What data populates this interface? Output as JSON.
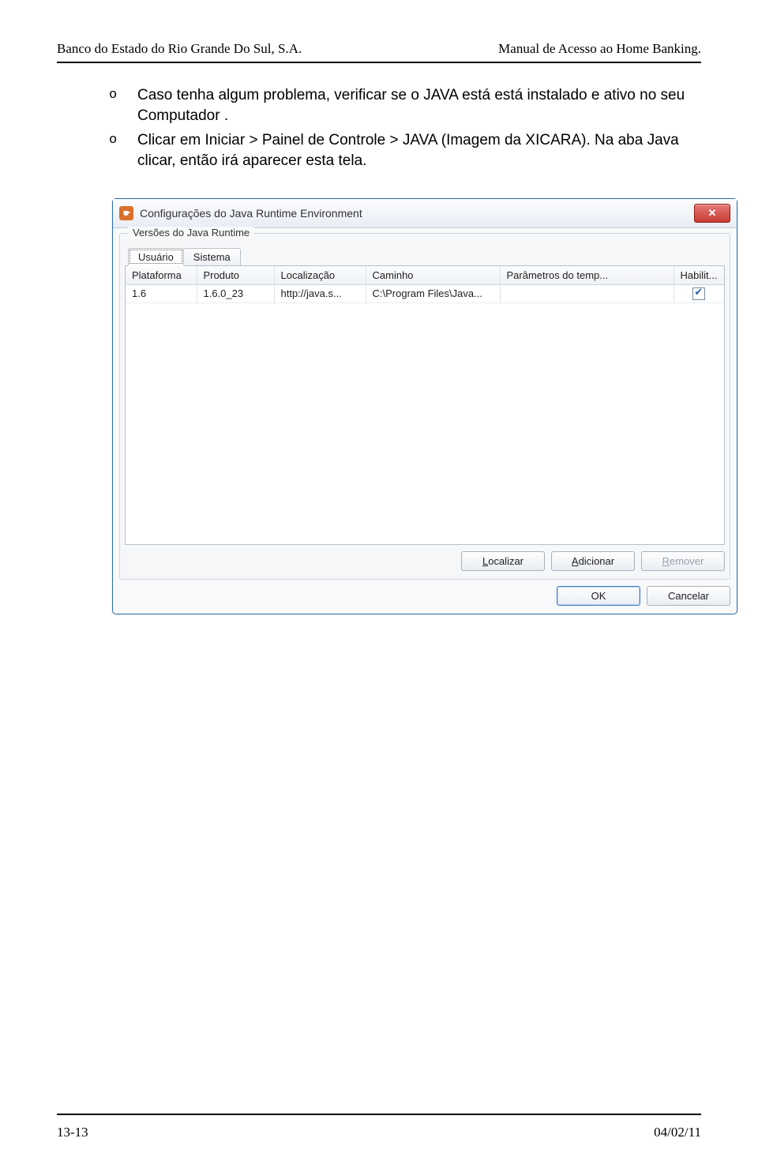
{
  "header": {
    "left": "Banco do Estado do Rio Grande Do Sul, S.A.",
    "right": "Manual de Acesso ao Home Banking."
  },
  "bullets": [
    "Caso tenha algum problema, verificar se o JAVA está está instalado e ativo no seu Computador .",
    "Clicar em Iniciar > Painel de Controle > JAVA (Imagem da XICARA). Na aba Java clicar, então irá aparecer esta tela."
  ],
  "window": {
    "title": "Configurações do Java Runtime Environment",
    "group_label": "Versões do Java Runtime",
    "tabs": {
      "usuario": "Usuário",
      "sistema": "Sistema"
    },
    "columns": {
      "plataforma": "Plataforma",
      "produto": "Produto",
      "localizacao": "Localização",
      "caminho": "Caminho",
      "parametros": "Parâmetros do temp...",
      "habilit": "Habilit..."
    },
    "row": {
      "plataforma": "1.6",
      "produto": "1.6.0_23",
      "localizacao": "http://java.s...",
      "caminho": "C:\\Program Files\\Java...",
      "parametros": "",
      "habilit_checked": "on"
    },
    "buttons": {
      "localizar": "Localizar",
      "adicionar": "Adicionar",
      "remover": "Remover",
      "ok": "OK",
      "cancelar": "Cancelar"
    }
  },
  "footer": {
    "left": "13-13",
    "right": "04/02/11"
  }
}
